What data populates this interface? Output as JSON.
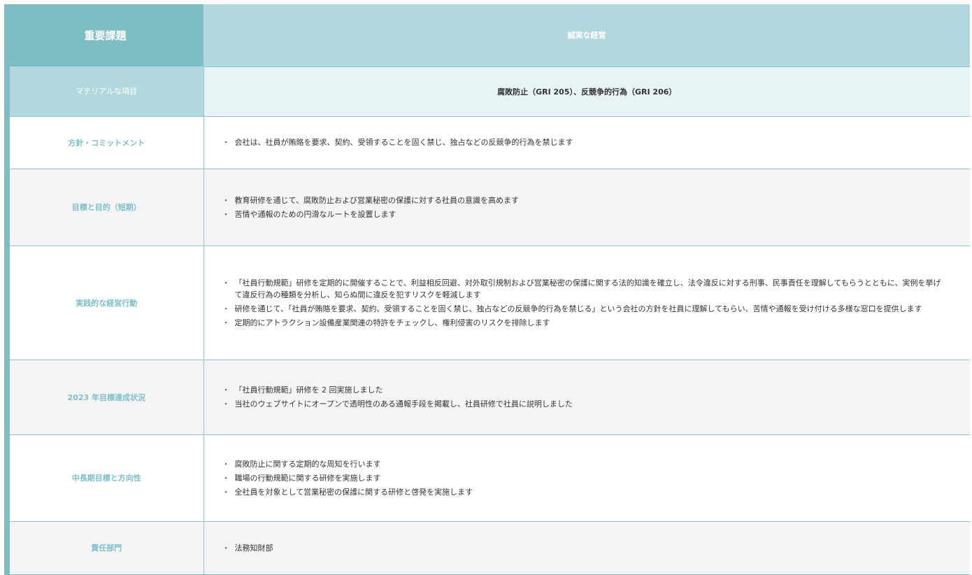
{
  "header": {
    "label": "重要課題",
    "value": "誠実な経営"
  },
  "material": {
    "label": "マテリアルな項目",
    "value": "腐敗防止（GRI 205）、反競争的行為（GRI 206）"
  },
  "rows": [
    {
      "label": "方針・コミットメント",
      "items": [
        "会社は、社員が賄賂を要求、契約、受領することを固く禁じ、独占などの反競争的行為を禁じます"
      ]
    },
    {
      "label": "目標と目的（短期）",
      "items": [
        "教育研修を通じて、腐敗防止および営業秘密の保護に対する社員の意識を高めます",
        "苦情や通報のための円滑なルートを設置します"
      ]
    },
    {
      "label": "実践的な経営行動",
      "items": [
        "「社員行動規範」研修を定期的に開催することで、利益相反回避、対外取引規制および営業秘密の保護に関する法的知識を確立し、法令違反に対する刑事、民事責任を理解してもらうとともに、実例を挙げて違反行為の種類を分析し、知らぬ間に違反を犯すリスクを軽減します",
        "研修を通じて、「社員が賄賂を要求、契約、受領することを固く禁じ、独占などの反競争的行為を禁じる」という会社の方針を社員に理解してもらい、苦情や通報を受け付ける多様な窓口を提供します",
        "定期的にアトラクション設備産業関連の特許をチェックし、権利侵害のリスクを排除します"
      ]
    },
    {
      "label": "2023 年目標達成状況",
      "items": [
        "「社員行動規範」研修を 2 回実施しました",
        "当社のウェブサイトにオープンで透明性のある通報手段を掲載し、社員研修で社員に説明しました"
      ]
    },
    {
      "label": "中長期目標と方向性",
      "items": [
        "腐敗防止に関する定期的な周知を行います",
        "職場の行動規範に関する研修を実施します",
        "全社員を対象として営業秘密の保護に関する研修と啓発を実施します"
      ]
    },
    {
      "label": "責任部門",
      "items": [
        "法務知財部"
      ]
    }
  ]
}
